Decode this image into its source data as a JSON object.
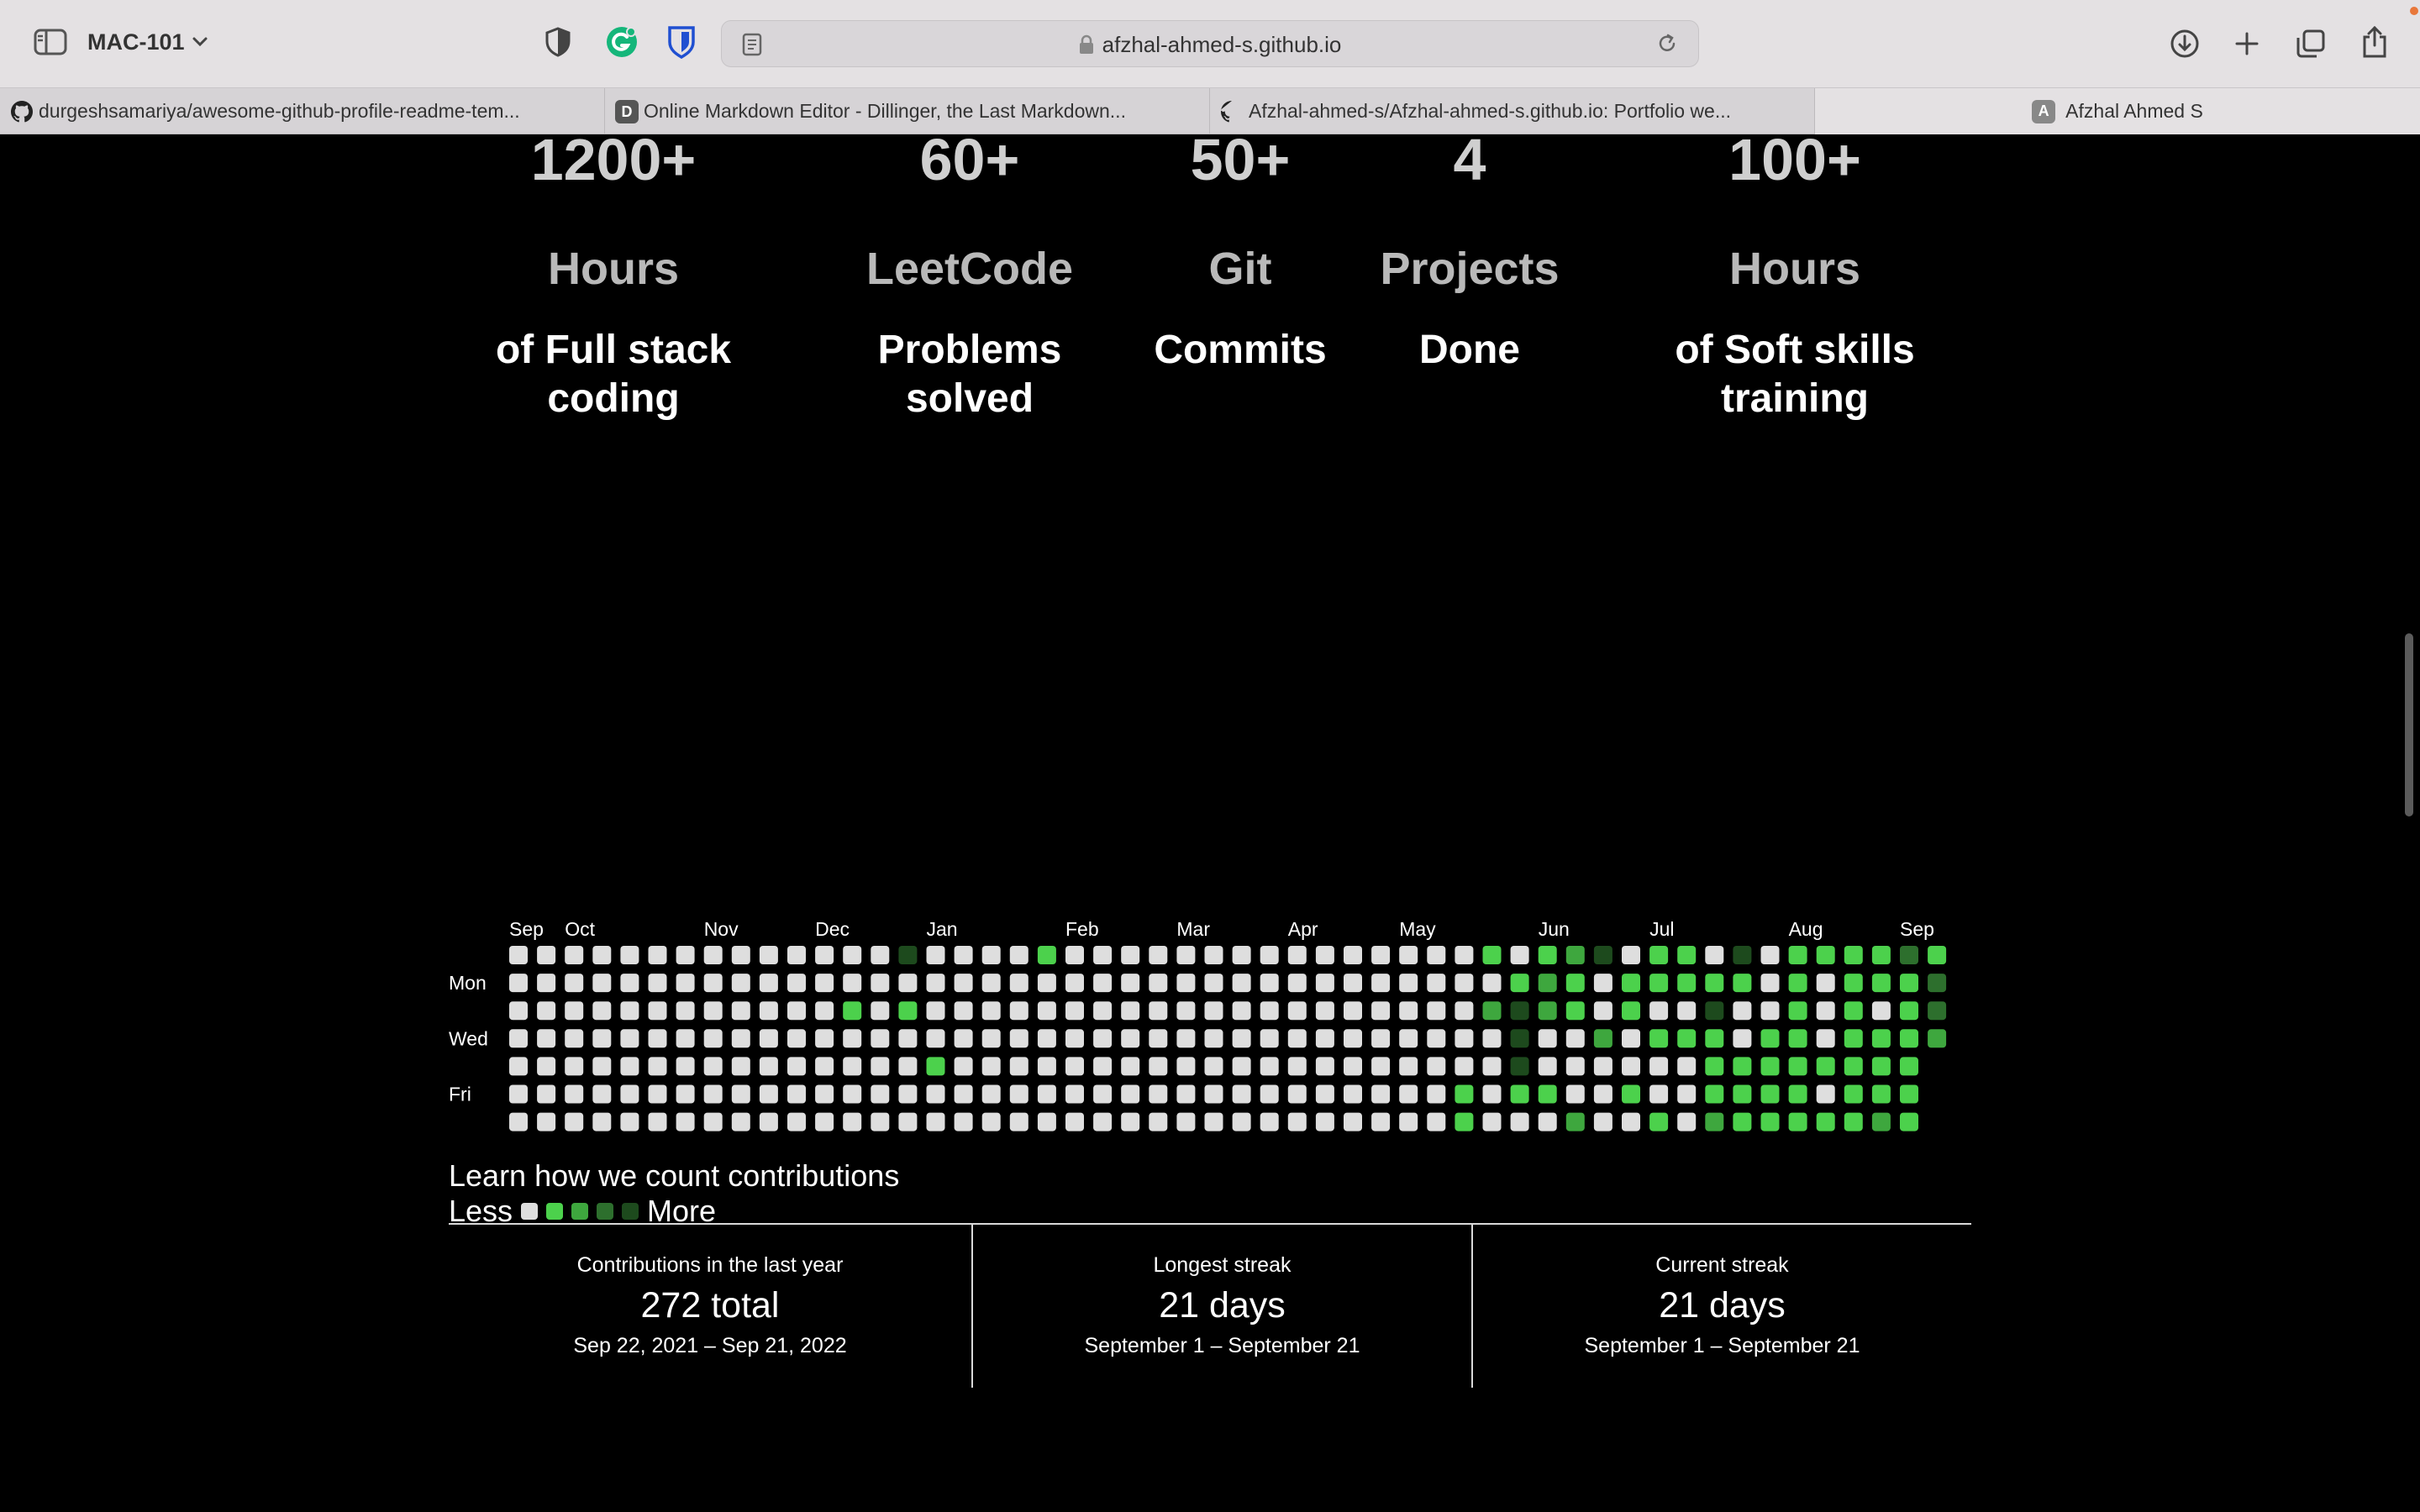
{
  "browser": {
    "profile_name": "MAC-101",
    "url": "afzhal-ahmed-s.github.io",
    "tabs": [
      {
        "title": "durgeshsamariya/awesome-github-profile-readme-tem...",
        "favicon": "github-icon"
      },
      {
        "title": "Online Markdown Editor - Dillinger, the Last Markdown...",
        "favicon": "dillinger-icon",
        "favicon_letter": "D"
      },
      {
        "title": "Afzhal-ahmed-s/Afzhal-ahmed-s.github.io: Portfolio we...",
        "favicon": "github-icon"
      },
      {
        "title": "Afzhal Ahmed S",
        "favicon": "letter-a-icon",
        "favicon_letter": "A",
        "active": true
      }
    ]
  },
  "stats": [
    {
      "number": "1200+",
      "unit": "Hours",
      "desc": "of Full stack coding"
    },
    {
      "number": "60+",
      "unit": "LeetCode",
      "desc": "Problems solved"
    },
    {
      "number": "50+",
      "unit": "Git",
      "desc": "Commits"
    },
    {
      "number": "4",
      "unit": "Projects",
      "desc": "Done"
    },
    {
      "number": "100+",
      "unit": "Hours",
      "desc": "of Soft skills training"
    }
  ],
  "contributions": {
    "months": [
      "Sep",
      "Oct",
      "Nov",
      "Dec",
      "Jan",
      "Feb",
      "Mar",
      "Apr",
      "May",
      "Jun",
      "Jul",
      "Aug",
      "Sep"
    ],
    "month_week_index": [
      0,
      2,
      7,
      11,
      15,
      20,
      24,
      28,
      32,
      37,
      41,
      46,
      50
    ],
    "day_labels": [
      "",
      "Mon",
      "",
      "Wed",
      "",
      "Fri",
      ""
    ],
    "level_colors": [
      "#dedede",
      "#4cd14c",
      "#3ea73e",
      "#2d6f2d",
      "#1d4a1d"
    ],
    "grid": [
      [
        0,
        0,
        0,
        0,
        0,
        0,
        0,
        0,
        0,
        0,
        0,
        0,
        0,
        0,
        4,
        0,
        0,
        0,
        0,
        1,
        0,
        0,
        0,
        0,
        0,
        0,
        0,
        0,
        0,
        0,
        0,
        0,
        0,
        0,
        0,
        1,
        0,
        1,
        2,
        4,
        0,
        1,
        1,
        0,
        4,
        0,
        1,
        1,
        1,
        1,
        3,
        1
      ],
      [
        0,
        0,
        0,
        0,
        0,
        0,
        0,
        0,
        0,
        0,
        0,
        0,
        0,
        0,
        0,
        0,
        0,
        0,
        0,
        0,
        0,
        0,
        0,
        0,
        0,
        0,
        0,
        0,
        0,
        0,
        0,
        0,
        0,
        0,
        0,
        0,
        1,
        2,
        1,
        0,
        1,
        1,
        1,
        1,
        1,
        0,
        1,
        0,
        1,
        1,
        1,
        3
      ],
      [
        0,
        0,
        0,
        0,
        0,
        0,
        0,
        0,
        0,
        0,
        0,
        0,
        1,
        0,
        1,
        0,
        0,
        0,
        0,
        0,
        0,
        0,
        0,
        0,
        0,
        0,
        0,
        0,
        0,
        0,
        0,
        0,
        0,
        0,
        0,
        2,
        4,
        2,
        1,
        0,
        1,
        0,
        0,
        4,
        0,
        0,
        1,
        0,
        1,
        0,
        1,
        3
      ],
      [
        0,
        0,
        0,
        0,
        0,
        0,
        0,
        0,
        0,
        0,
        0,
        0,
        0,
        0,
        0,
        0,
        0,
        0,
        0,
        0,
        0,
        0,
        0,
        0,
        0,
        0,
        0,
        0,
        0,
        0,
        0,
        0,
        0,
        0,
        0,
        0,
        4,
        0,
        0,
        2,
        0,
        1,
        1,
        1,
        0,
        1,
        1,
        0,
        1,
        1,
        1,
        2
      ],
      [
        0,
        0,
        0,
        0,
        0,
        0,
        0,
        0,
        0,
        0,
        0,
        0,
        0,
        0,
        0,
        1,
        0,
        0,
        0,
        0,
        0,
        0,
        0,
        0,
        0,
        0,
        0,
        0,
        0,
        0,
        0,
        0,
        0,
        0,
        0,
        0,
        4,
        0,
        0,
        0,
        0,
        0,
        0,
        1,
        1,
        1,
        1,
        1,
        1,
        1,
        1
      ],
      [
        0,
        0,
        0,
        0,
        0,
        0,
        0,
        0,
        0,
        0,
        0,
        0,
        0,
        0,
        0,
        0,
        0,
        0,
        0,
        0,
        0,
        0,
        0,
        0,
        0,
        0,
        0,
        0,
        0,
        0,
        0,
        0,
        0,
        0,
        1,
        0,
        1,
        1,
        0,
        0,
        1,
        0,
        0,
        1,
        1,
        1,
        1,
        0,
        1,
        1,
        1
      ],
      [
        0,
        0,
        0,
        0,
        0,
        0,
        0,
        0,
        0,
        0,
        0,
        0,
        0,
        0,
        0,
        0,
        0,
        0,
        0,
        0,
        0,
        0,
        0,
        0,
        0,
        0,
        0,
        0,
        0,
        0,
        0,
        0,
        0,
        0,
        1,
        0,
        0,
        0,
        2,
        0,
        0,
        1,
        0,
        2,
        1,
        1,
        1,
        1,
        1,
        2,
        1
      ]
    ],
    "learn_link": "Learn how we count contributions",
    "legend_less": "Less",
    "legend_more": "More",
    "summary": [
      {
        "label": "Contributions in the last year",
        "value": "272 total",
        "range": "Sep 22, 2021 – Sep 21, 2022"
      },
      {
        "label": "Longest streak",
        "value": "21 days",
        "range": "September 1 – September 21"
      },
      {
        "label": "Current streak",
        "value": "21 days",
        "range": "September 1 – September 21"
      }
    ]
  }
}
